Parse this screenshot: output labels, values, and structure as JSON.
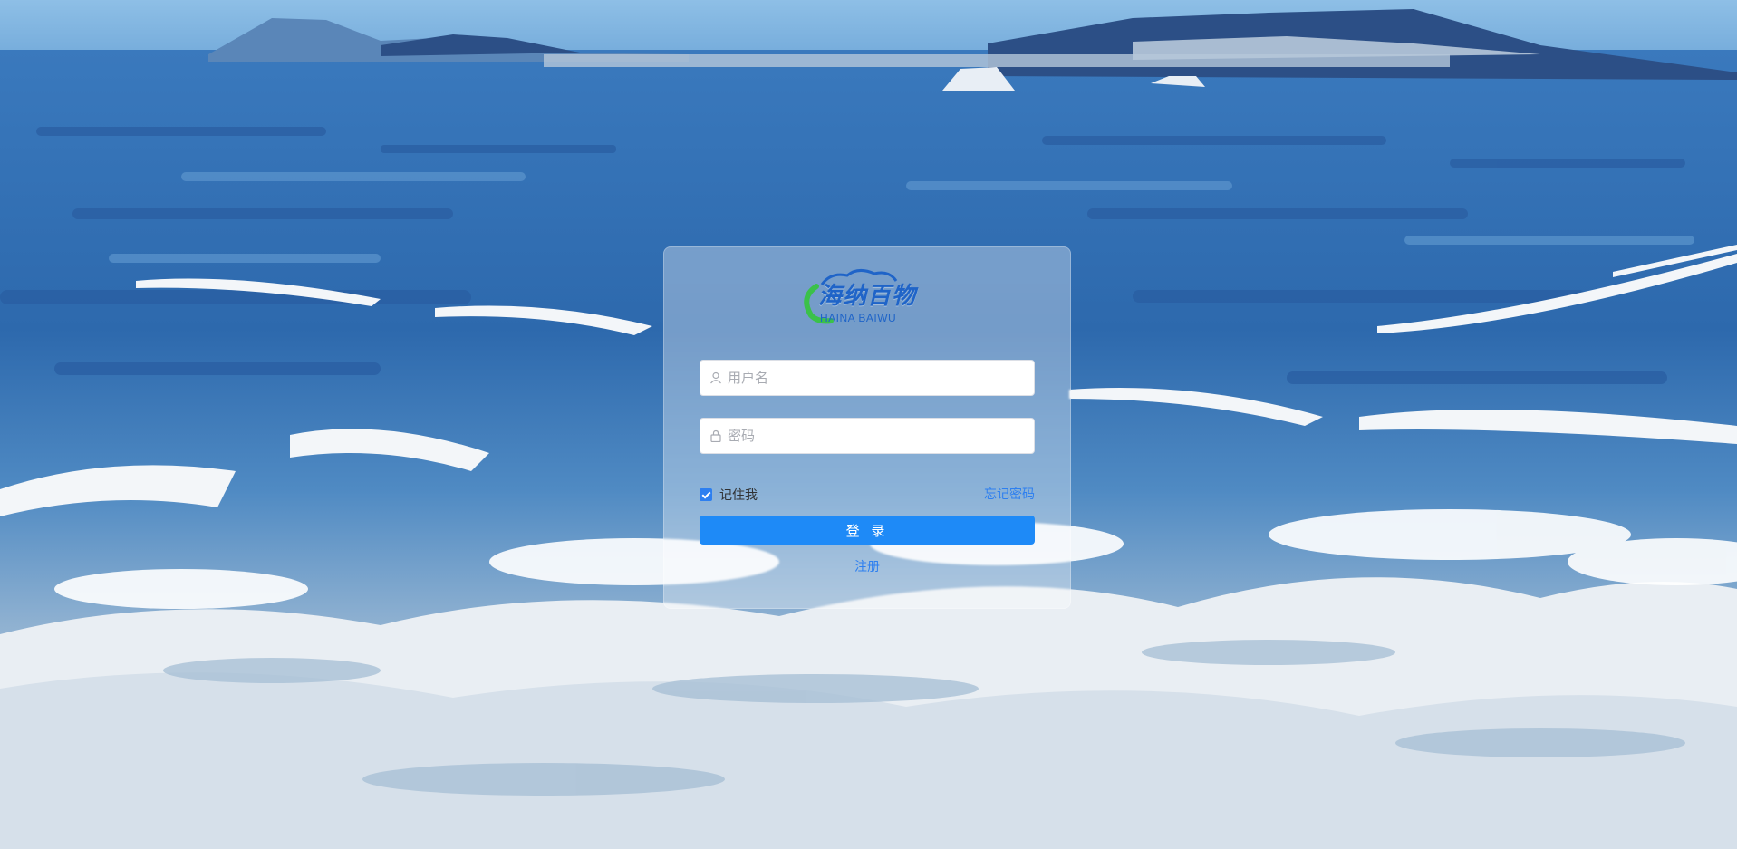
{
  "brand": {
    "name": "海纳百物",
    "subtitle": "HAINA BAIWU",
    "primary_color": "#1f64c8",
    "accent_color": "#3bc14a"
  },
  "login": {
    "username_placeholder": "用户名",
    "password_placeholder": "密码",
    "remember_label": "记住我",
    "remember_checked": true,
    "forgot_label": "忘记密码",
    "submit_label": "登 录",
    "register_label": "注册"
  },
  "colors": {
    "button": "#1e8af7",
    "link": "#2d7ff0",
    "sky": "#7fb2e0",
    "sea": "#2f6fb3"
  },
  "icons": {
    "username": "user-icon",
    "password": "lock-icon"
  }
}
